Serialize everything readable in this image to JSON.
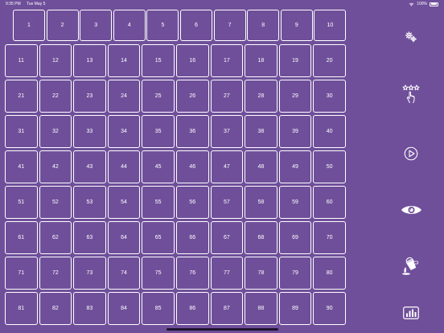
{
  "status_bar": {
    "time": "9:35 PM",
    "date": "Tue May 5",
    "battery": "100%",
    "icons": [
      "wifi-icon",
      "battery-icon"
    ]
  },
  "grid": {
    "top_row": [
      1,
      2,
      3,
      4,
      5,
      6,
      7,
      8,
      9,
      10
    ],
    "rows": [
      [
        11,
        12,
        13,
        14,
        15,
        16,
        17,
        18,
        19,
        20
      ],
      [
        21,
        22,
        23,
        24,
        25,
        26,
        27,
        28,
        29,
        30
      ],
      [
        31,
        32,
        33,
        34,
        35,
        36,
        37,
        38,
        39,
        40
      ],
      [
        41,
        42,
        43,
        44,
        45,
        46,
        47,
        48,
        49,
        50
      ],
      [
        51,
        52,
        53,
        54,
        55,
        56,
        57,
        58,
        59,
        60
      ],
      [
        61,
        62,
        63,
        64,
        65,
        66,
        67,
        68,
        69,
        70
      ],
      [
        71,
        72,
        73,
        74,
        75,
        76,
        77,
        78,
        79,
        80
      ],
      [
        81,
        82,
        83,
        84,
        85,
        86,
        87,
        88,
        89,
        90
      ]
    ]
  },
  "toolbar": {
    "icons": [
      "gears-icon",
      "stars-tap-icon",
      "play-icon",
      "eye-icon",
      "paint-bucket-icon",
      "bar-chart-icon"
    ]
  },
  "colors": {
    "background": "#6f4f9a",
    "foreground": "#ffffff"
  }
}
